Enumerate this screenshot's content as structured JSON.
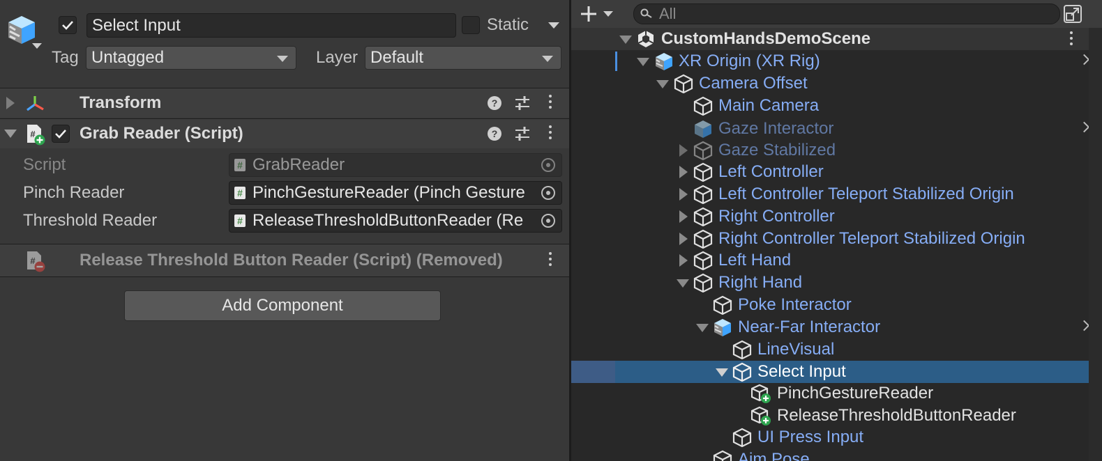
{
  "inspector": {
    "object_name": "Select Input",
    "active_checked": true,
    "static_label": "Static",
    "tag_label": "Tag",
    "tag_value": "Untagged",
    "layer_label": "Layer",
    "layer_value": "Default",
    "components": {
      "transform": {
        "title": "Transform"
      },
      "grab_reader": {
        "title": "Grab Reader (Script)",
        "props": {
          "script": {
            "label": "Script",
            "value": "GrabReader"
          },
          "pinch": {
            "label": "Pinch Reader",
            "value": "PinchGestureReader (Pinch Gesture"
          },
          "threshold": {
            "label": "Threshold Reader",
            "value": "ReleaseThresholdButtonReader (Re"
          }
        }
      },
      "removed": {
        "title": "Release Threshold Button Reader (Script) (Removed)"
      }
    },
    "add_component_label": "Add Component"
  },
  "hierarchy": {
    "search_placeholder": "All",
    "scene_name": "CustomHandsDemoScene",
    "items": [
      {
        "label": "XR Origin (XR Rig)"
      },
      {
        "label": "Camera Offset"
      },
      {
        "label": "Main Camera"
      },
      {
        "label": "Gaze Interactor"
      },
      {
        "label": "Gaze Stabilized"
      },
      {
        "label": "Left Controller"
      },
      {
        "label": "Left Controller Teleport Stabilized Origin"
      },
      {
        "label": "Right Controller"
      },
      {
        "label": "Right Controller Teleport Stabilized Origin"
      },
      {
        "label": "Left Hand"
      },
      {
        "label": "Right Hand"
      },
      {
        "label": "Poke Interactor"
      },
      {
        "label": "Near-Far Interactor"
      },
      {
        "label": "LineVisual"
      },
      {
        "label": "Select Input"
      },
      {
        "label": "PinchGestureReader"
      },
      {
        "label": "ReleaseThresholdButtonReader"
      },
      {
        "label": "UI Press Input"
      },
      {
        "label": "Aim Pose"
      }
    ]
  }
}
